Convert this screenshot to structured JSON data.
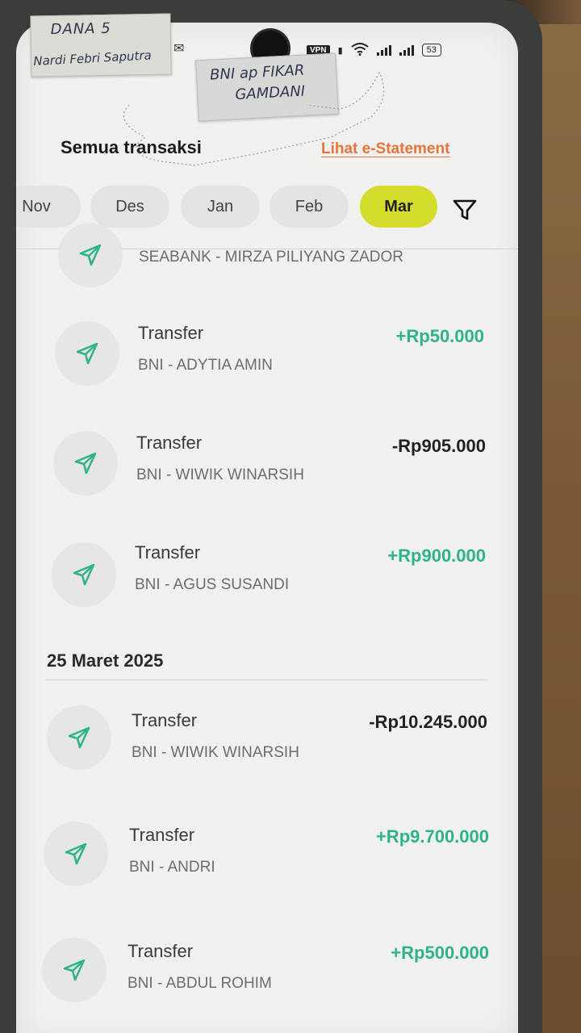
{
  "status_bar": {
    "vpn": "VPN",
    "battery": "53"
  },
  "stickers": {
    "left_line1": "DANA 5",
    "left_line2": "Nardi Febri Saputra",
    "center_line1": "BNI ap FIKAR",
    "center_line2": "GAMDANI"
  },
  "header": {
    "title": "Semua transaksi",
    "statement_link": "Lihat e-Statement"
  },
  "month_tabs": [
    "Nov",
    "Des",
    "Jan",
    "Feb",
    "Mar"
  ],
  "active_month": "Mar",
  "partial_row": {
    "subtitle": "SEABANK - MIRZA PILIYANG ZADOR"
  },
  "transactions_top": [
    {
      "title": "Transfer",
      "subtitle": "BNI - ADYTIA AMIN",
      "amount": "+Rp50.000",
      "direction": "in"
    },
    {
      "title": "Transfer",
      "subtitle": "BNI - WIWIK WINARSIH",
      "amount": "-Rp905.000",
      "direction": "out"
    },
    {
      "title": "Transfer",
      "subtitle": "BNI - AGUS SUSANDI",
      "amount": "+Rp900.000",
      "direction": "in"
    }
  ],
  "date_group": "25 Maret 2025",
  "transactions_bottom": [
    {
      "title": "Transfer",
      "subtitle": "BNI - WIWIK WINARSIH",
      "amount": "-Rp10.245.000",
      "direction": "out"
    },
    {
      "title": "Transfer",
      "subtitle": "BNI - ANDRI",
      "amount": "+Rp9.700.000",
      "direction": "in"
    },
    {
      "title": "Transfer",
      "subtitle": "BNI - ABDUL ROHIM",
      "amount": "+Rp500.000",
      "direction": "in"
    }
  ],
  "colors": {
    "positive": "#2fb38a",
    "negative": "#222222",
    "accent_link": "#e8743a",
    "active_tab": "#d4dc2c"
  },
  "icons": {
    "transaction": "paper-plane-icon",
    "filter": "filter-icon"
  }
}
